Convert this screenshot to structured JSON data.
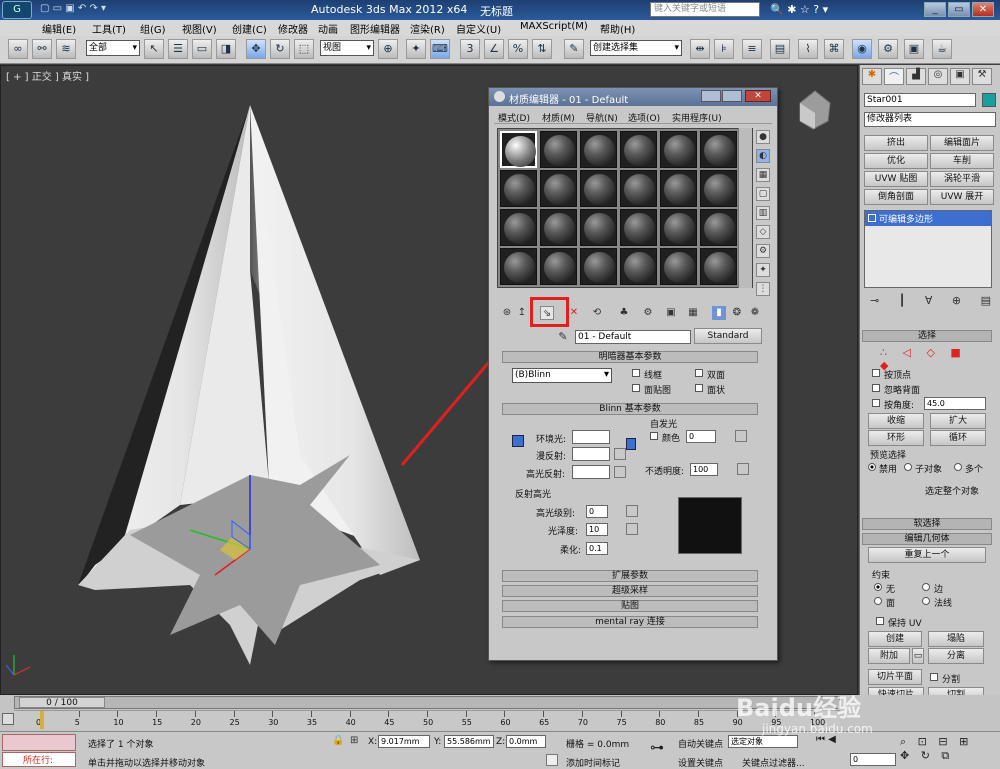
{
  "app": {
    "title_text": "Autodesk 3ds Max  2012 x64",
    "doc_title": "无标题",
    "search_placeholder": "键入关键字或短语"
  },
  "menu": [
    "编辑(E)",
    "工具(T)",
    "组(G)",
    "视图(V)",
    "创建(C)",
    "修改器",
    "动画",
    "图形编辑器",
    "渲染(R)",
    "自定义(U)",
    "MAXScript(M)",
    "帮助(H)"
  ],
  "toolbar": {
    "selection_filter": "全部",
    "ref_coord": "视图",
    "named_selection": "创建选择集"
  },
  "viewport": {
    "label": "[ + ] 正交 ] 真实 ]"
  },
  "material_editor": {
    "title": "材质编辑器 - 01 - Default",
    "menu": [
      "模式(D)",
      "材质(M)",
      "导航(N)",
      "选项(O)",
      "实用程序(U)"
    ],
    "material_name": "01 - Default",
    "material_type": "Standard",
    "shader_rollout": "明暗器基本参数",
    "shader_type": "(B)Blinn",
    "opt_wire": "线框",
    "opt_2sided": "双面",
    "opt_facemap": "面贴图",
    "opt_faceted": "面状",
    "blinn_rollout": "Blinn 基本参数",
    "self_illum": "自发光",
    "self_illum_color": "颜色",
    "self_illum_value": "0",
    "ambient": "环境光:",
    "diffuse": "漫反射:",
    "specular": "高光反射:",
    "opacity_label": "不透明度:",
    "opacity_value": "100",
    "spec_highlights": "反射高光",
    "spec_level_label": "高光级别:",
    "spec_level": "0",
    "glossiness_label": "光泽度:",
    "glossiness": "10",
    "soften_label": "柔化:",
    "soften": "0.1",
    "rollouts": [
      "扩展参数",
      "超级采样",
      "贴图",
      "mental ray 连接"
    ]
  },
  "command_panel": {
    "object_name": "Star001",
    "modifier_list": "修改器列表",
    "mod_buttons": [
      "挤出",
      "编辑面片",
      "优化",
      "车削",
      "UVW 贴图",
      "涡轮平滑",
      "倒角剖面",
      "UVW 展开"
    ],
    "stack_item": "可编辑多边形",
    "selection_rollout": "选择",
    "by_vertex": "按顶点",
    "ignore_backfacing": "忽略背面",
    "by_angle": "按角度:",
    "angle_value": "45.0",
    "shrink": "收缩",
    "grow": "扩大",
    "ring": "环形",
    "loop": "循环",
    "preview_selection": "预览选择",
    "preview_off": "禁用",
    "preview_subobj": "子对象",
    "preview_multi": "多个",
    "selected_status": "选定整个对象",
    "soft_selection": "软选择",
    "edit_geometry": "编辑几何体",
    "repeat_last": "重复上一个",
    "constraints": "约束",
    "c_none": "无",
    "c_edge": "边",
    "c_face": "面",
    "c_normal": "法线",
    "preserve_uv": "保持 UV",
    "create": "创建",
    "collapse": "塌陷",
    "attach": "附加",
    "detach": "分离",
    "slice_plane": "切片平面",
    "split": "分割",
    "quickslice": "快速切片",
    "cut": "切割"
  },
  "timeline": {
    "frame": "0 / 100",
    "ticks": [
      "0",
      "5",
      "10",
      "15",
      "20",
      "25",
      "30",
      "35",
      "40",
      "45",
      "50",
      "55",
      "60",
      "65",
      "70",
      "75",
      "80",
      "85",
      "90",
      "95",
      "100"
    ]
  },
  "status": {
    "mode": "所在行:",
    "message1": "选择了 1 个对象",
    "message2": "单击并拖动以选择并移动对象",
    "x_label": "X:",
    "x_value": "9.017mm",
    "y_label": "Y:",
    "y_value": "55.586mm",
    "z_label": "Z:",
    "z_value": "0.0mm",
    "grid": "栅格 = 0.0mm",
    "add_time_tag": "添加时间标记",
    "auto_key": "自动关键点",
    "set_key": "设置关键点",
    "selected": "选定对象",
    "key_filters": "关键点过滤器...",
    "frame_field": "0"
  },
  "watermark": {
    "text": "Baidu经验",
    "url": "jingyan.baidu.com"
  },
  "colors": {
    "annotation": "#e0201c",
    "accent_blue": "#2b5a9b",
    "highlight": "#3d6fd0"
  }
}
